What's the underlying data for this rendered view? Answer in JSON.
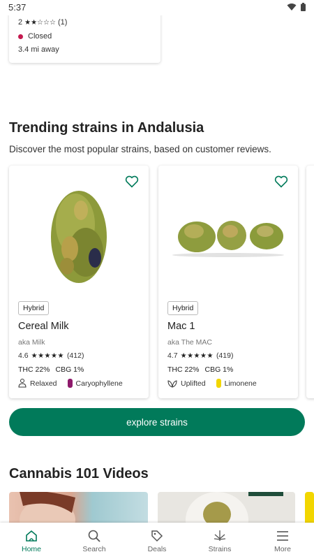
{
  "status_bar": {
    "time": "5:37"
  },
  "prev_dispensary": {
    "rating_value": "2",
    "stars": "★★☆☆☆",
    "review_count": "(1)",
    "status": "Closed",
    "distance": "3.4 mi away"
  },
  "trending": {
    "title": "Trending strains in Andalusia",
    "subtitle": "Discover the most popular strains, based on customer reviews.",
    "strains": [
      {
        "type": "Hybrid",
        "name": "Cereal Milk",
        "aka": "aka Milk",
        "rating": "4.6",
        "stars": "★★★★★",
        "reviews": "(412)",
        "thc": "THC 22%",
        "cbg": "CBG 1%",
        "effect": "Relaxed",
        "terpene": "Caryophyllene",
        "terpene_color": "#8e1a6b"
      },
      {
        "type": "Hybrid",
        "name": "Mac 1",
        "aka": "aka The MAC",
        "rating": "4.7",
        "stars": "★★★★★",
        "reviews": "(419)",
        "thc": "THC 22%",
        "cbg": "CBG 1%",
        "effect": "Uplifted",
        "terpene": "Limonene",
        "terpene_color": "#f2d600"
      }
    ],
    "explore_label": "explore strains"
  },
  "videos": {
    "title": "Cannabis 101 Videos"
  },
  "bottom_nav": {
    "items": [
      {
        "label": "Home",
        "icon": "home-icon"
      },
      {
        "label": "Search",
        "icon": "search-icon"
      },
      {
        "label": "Deals",
        "icon": "tag-icon"
      },
      {
        "label": "Strains",
        "icon": "leaf-icon"
      },
      {
        "label": "More",
        "icon": "menu-icon"
      }
    ]
  },
  "colors": {
    "brand": "#017a5a",
    "closed": "#c4194f"
  }
}
